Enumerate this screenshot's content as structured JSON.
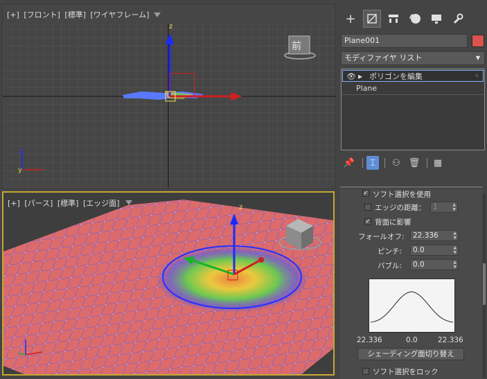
{
  "viewports": {
    "front": {
      "labels": [
        "[+]",
        "[フロント]",
        "[標準]",
        "[ワイヤフレーム]"
      ],
      "viewcube_label": "前"
    },
    "perspective": {
      "labels": [
        "[+]",
        "[パース]",
        "[標準]",
        "[エッジ面]"
      ]
    },
    "axis": {
      "x": "x",
      "y": "y",
      "z": "z"
    }
  },
  "panel": {
    "tabs": [
      {
        "name": "create",
        "icon": "+"
      },
      {
        "name": "modify",
        "icon": "modify-icon"
      },
      {
        "name": "hierarchy",
        "icon": "hierarchy-icon"
      },
      {
        "name": "motion",
        "icon": "motion-icon"
      },
      {
        "name": "display",
        "icon": "display-icon"
      },
      {
        "name": "utilities",
        "icon": "wrench-icon"
      }
    ],
    "object_name": "Plane001",
    "object_color": "#d9534f",
    "modifier_list": "モディファイヤ リスト",
    "stack": [
      {
        "label": "ポリゴンを編集",
        "selected": true
      },
      {
        "label": "Plane",
        "selected": false
      }
    ],
    "soft_selection": {
      "use_soft_selection": "ソフト選択を使用",
      "edge_distance_label": "エッジの距離：",
      "edge_distance_value": "1",
      "affect_backfacing": "背面に影響",
      "falloff_label": "フォールオフ:",
      "falloff_value": "22.336",
      "pinch_label": "ピンチ:",
      "pinch_value": "0.0",
      "bubble_label": "バブル:",
      "bubble_value": "0.0",
      "curve_left": "22.336",
      "curve_mid": "0.0",
      "curve_right": "22.336",
      "shaded_face_toggle": "シェーディング面切り替え",
      "lock_soft_selection": "ソフト選択をロック"
    }
  }
}
